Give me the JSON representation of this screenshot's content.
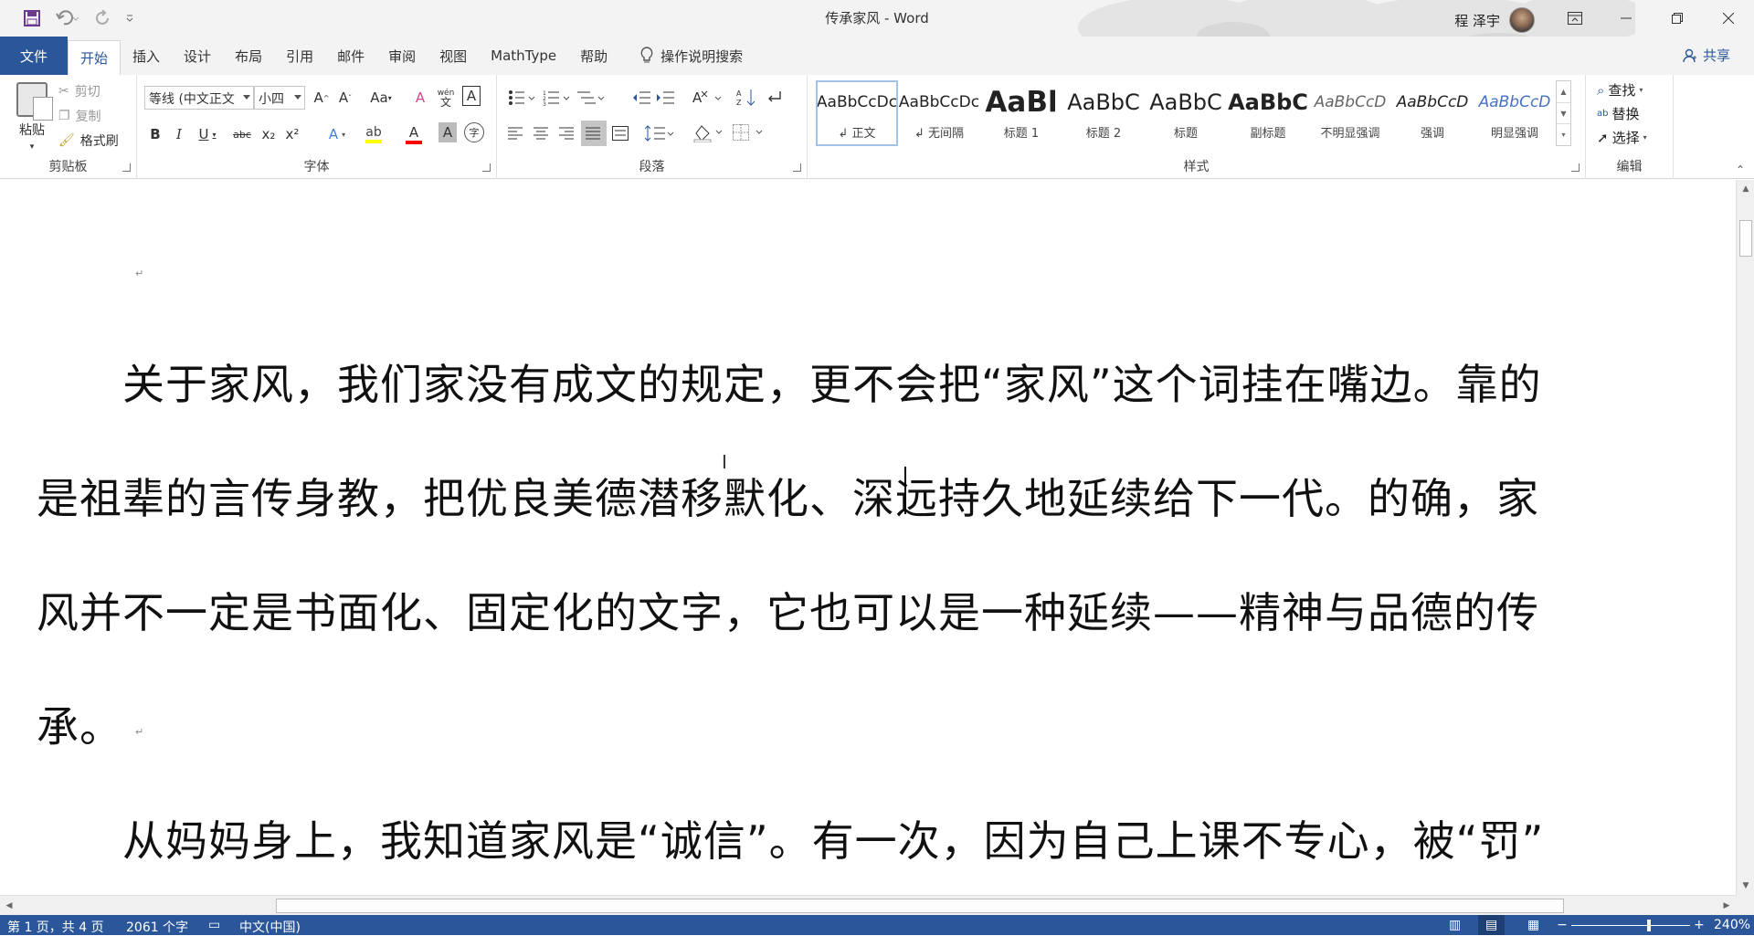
{
  "window": {
    "title": "传承家风 - Word",
    "user_name": "程 泽宇"
  },
  "tabs": {
    "file": "文件",
    "items": [
      "开始",
      "插入",
      "设计",
      "布局",
      "引用",
      "邮件",
      "审阅",
      "视图",
      "MathType",
      "帮助"
    ],
    "active": "开始",
    "tell_me": "操作说明搜索",
    "share": "共享"
  },
  "ribbon": {
    "clipboard": {
      "label": "剪贴板",
      "paste": "粘贴",
      "cut": "剪切",
      "copy": "复制",
      "format_painter": "格式刷"
    },
    "font": {
      "label": "字体",
      "font_name": "等线 (中文正文",
      "font_size": "小四",
      "change_case": "Aa",
      "bold": "B",
      "italic": "I",
      "underline": "U",
      "strikethrough": "abc",
      "subscript": "x₂",
      "superscript": "x²",
      "wen": "wén",
      "char_border": "A",
      "char_shading": "A",
      "enclosed_char": "字"
    },
    "paragraph": {
      "label": "段落"
    },
    "styles": {
      "label": "样式",
      "items": [
        {
          "sample": "AaBbCcDc",
          "name": "↲ 正文"
        },
        {
          "sample": "AaBbCcDc",
          "name": "↲ 无间隔"
        },
        {
          "sample": "AaBl",
          "name": "标题 1"
        },
        {
          "sample": "AaBbC",
          "name": "标题 2"
        },
        {
          "sample": "AaBbC",
          "name": "标题"
        },
        {
          "sample": "AaBbC",
          "name": "副标题"
        },
        {
          "sample": "AaBbCcD",
          "name": "不明显强调"
        },
        {
          "sample": "AaBbCcD",
          "name": "强调"
        },
        {
          "sample": "AaBbCcD",
          "name": "明显强调"
        }
      ]
    },
    "editing": {
      "label": "编辑",
      "find": "查找",
      "replace": "替换",
      "select": "选择"
    }
  },
  "document": {
    "lines": [
      "　　关于家风，我们家没有成文的规定，更不会把“家风”这个词挂在嘴边。靠的",
      "是祖辈的言传身教，把优良美德潜移默化、深远持久地延续给下一代。的确，家",
      "风并不一定是书面化、固定化的文字，它也可以是一种延续——精神与品德的传",
      "承。",
      "　　从妈妈身上，我知道家风是“诚信”。有一次，因为自己上课不专心，被“罚”"
    ],
    "paragraph_mark": "↵"
  },
  "statusbar": {
    "page": "第 1 页，共 4 页",
    "words": "2061 个字",
    "language": "中文(中国)",
    "zoom_minus": "−",
    "zoom_plus": "+",
    "zoom": "240%",
    "zoom_fraction": 0.65
  },
  "colors": {
    "accent": "#2b579a",
    "highlight": "#ffff00",
    "font_color": "#ff0000"
  }
}
